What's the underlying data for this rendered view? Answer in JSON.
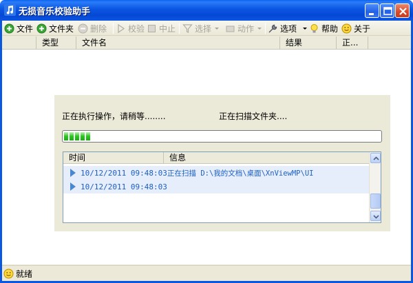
{
  "window": {
    "title": "无损音乐校验助手"
  },
  "toolbar": {
    "items": [
      {
        "label": "文件",
        "icon": "add-icon",
        "enabled": true
      },
      {
        "label": "文件夹",
        "icon": "add-folder-icon",
        "enabled": true
      },
      {
        "label": "删除",
        "icon": "remove-icon",
        "enabled": false
      },
      {
        "label": "校验",
        "icon": "play-icon",
        "enabled": false
      },
      {
        "label": "中止",
        "icon": "stop-icon",
        "enabled": false
      },
      {
        "label": "选择",
        "icon": "filter-icon",
        "enabled": false
      },
      {
        "label": "动作",
        "icon": "action-icon",
        "enabled": false
      },
      {
        "label": "选项",
        "icon": "wrench-icon",
        "enabled": true
      },
      {
        "label": "帮助",
        "icon": "lightbulb-icon",
        "enabled": true
      },
      {
        "label": "关于",
        "icon": "smiley-icon",
        "enabled": true
      }
    ]
  },
  "list": {
    "columns": [
      "类型",
      "文件名",
      "结果",
      "正..."
    ]
  },
  "progress_panel": {
    "status_message": "正在执行操作，请稍等........",
    "scan_message": "正在扫描文件夹....",
    "progress_percent": 8,
    "log": {
      "columns": [
        "时间",
        "信息"
      ],
      "rows": [
        {
          "time": "10/12/2011 09:48:03",
          "message": "正在扫描 D:\\我的文档\\桌面\\XnViewMP\\UI"
        },
        {
          "time": "10/12/2011 09:48:03",
          "message": ""
        }
      ]
    }
  },
  "statusbar": {
    "text": "就绪",
    "icon": "smiley-icon"
  },
  "colors": {
    "titlebar": "#0a58e0",
    "progress_fill": "#28c71d",
    "log_text": "#1a5fc5",
    "log_row_bg": "#e7eefb"
  }
}
